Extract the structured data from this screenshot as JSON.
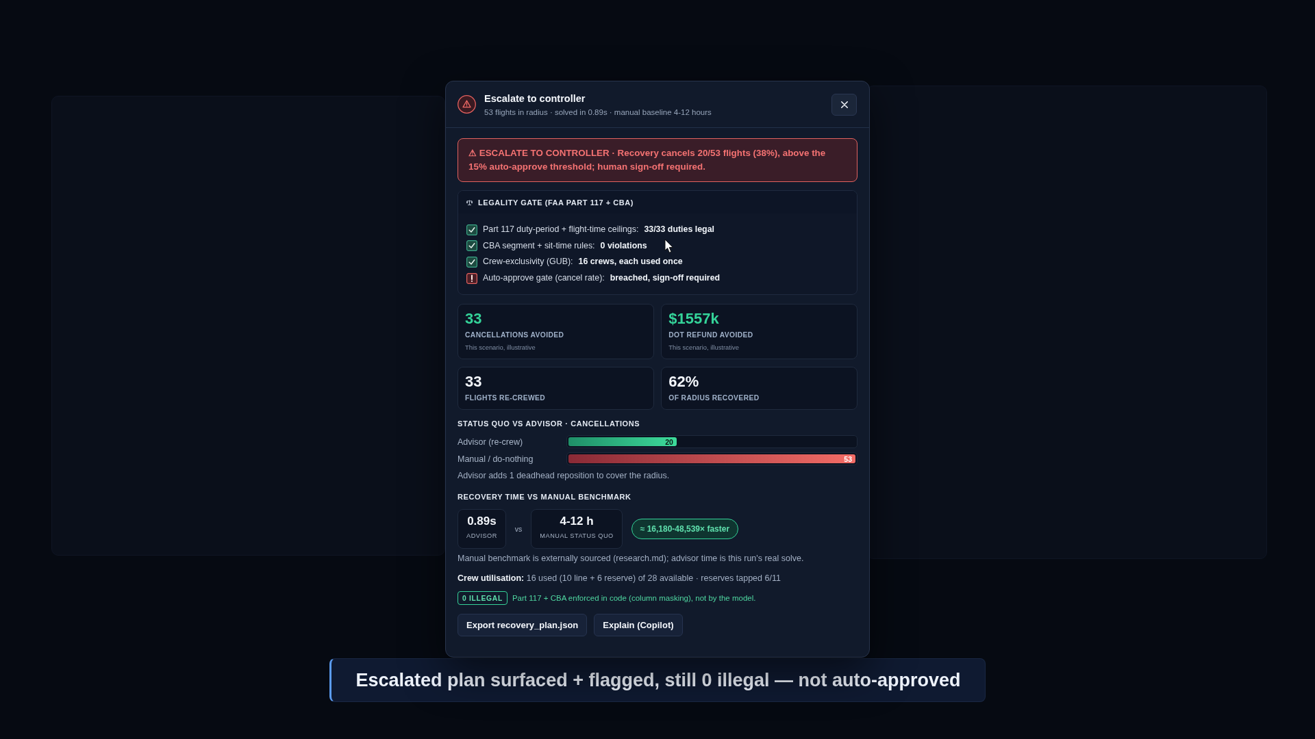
{
  "dialog": {
    "title": "Escalate to controller",
    "subtitle": "53 flights in radius · solved in 0.89s · manual baseline 4-12 hours",
    "alert": "⚠ ESCALATE TO CONTROLLER · Recovery cancels 20/53 flights (38%), above the 15% auto-approve threshold; human sign-off required.",
    "legality_gate": {
      "title": "LEGALITY GATE (FAA PART 117 + CBA)",
      "checks": [
        {
          "label": "Part 117 duty-period + flight-time ceilings:",
          "value": "33/33 duties legal",
          "passed": true
        },
        {
          "label": "CBA segment + sit-time rules:",
          "value": "0 violations",
          "passed": true
        },
        {
          "label": "Crew-exclusivity (GUB):",
          "value": "16 crews, each used once",
          "passed": true
        },
        {
          "label": "Auto-approve gate (cancel rate):",
          "value": "breached, sign-off required",
          "passed": false
        }
      ]
    },
    "metrics": [
      {
        "value": "33",
        "label": "CANCELLATIONS AVOIDED",
        "note": "This scenario, illustrative",
        "kind": "highlight"
      },
      {
        "value": "$1557k",
        "label": "DOT REFUND AVOIDED",
        "note": "This scenario, illustrative",
        "kind": "highlight"
      },
      {
        "value": "33",
        "label": "FLIGHTS RE-CREWED",
        "kind": "plain"
      },
      {
        "value": "62%",
        "label": "OF RADIUS RECOVERED",
        "kind": "plain"
      }
    ],
    "comparison": {
      "title": "STATUS QUO VS ADVISOR · CANCELLATIONS",
      "bars": [
        {
          "label": "Advisor (re-crew)",
          "value": "20",
          "level": 0.377,
          "kind": "advisor"
        },
        {
          "label": "Manual / do-nothing",
          "value": "53",
          "level": 1,
          "kind": "manual"
        }
      ],
      "note": "Advisor adds 1 deadhead reposition to cover the radius."
    },
    "recovery_time": {
      "title": "RECOVERY TIME VS MANUAL BENCHMARK",
      "advisor": {
        "value": "0.89s",
        "label": "ADVISOR"
      },
      "separator": "vs",
      "manual": {
        "value": "4-12 h",
        "label": "MANUAL STATUS QUO"
      },
      "speedup": "≈ 16,180-48,539× faster",
      "note": "Manual benchmark is externally sourced (research.md); advisor time is this run's real solve."
    },
    "crew_utilisation": "**Crew utilisation:** 16 used (10 line + 6 reserve) of 28 available · reserves tapped 6/11",
    "illegal_badge": "0 ILLEGAL",
    "enforcement_note": "Part 117 + CBA enforced in code (column masking), not by the model.",
    "buttons": [
      "Export recovery_plan.json",
      "Explain (Copilot)"
    ]
  },
  "caption": "Escalated plan surfaced + flagged, still 0 illegal — not auto-approved"
}
